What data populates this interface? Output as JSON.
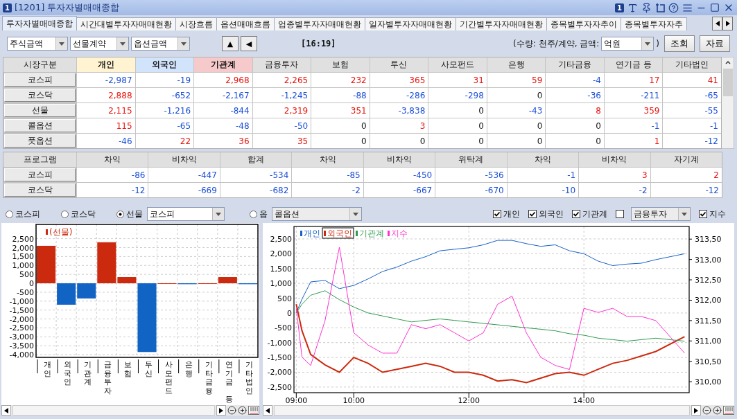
{
  "window": {
    "badge": "1",
    "title": "[1201] 투자자별매매종합",
    "toolbar_badge": "1"
  },
  "tabs": [
    {
      "label": "투자자별매매종합",
      "selected": true
    },
    {
      "label": "시간대별투자자매매현황",
      "selected": false
    },
    {
      "label": "시장흐름",
      "selected": false
    },
    {
      "label": "옵션매매흐름",
      "selected": false
    },
    {
      "label": "업종별투자자매매현황",
      "selected": false
    },
    {
      "label": "일자별투자자매매현황",
      "selected": false
    },
    {
      "label": "기간별투자자매매현황",
      "selected": false
    },
    {
      "label": "종목별투자자추이",
      "selected": false
    },
    {
      "label": "종목별투자자추",
      "selected": false
    }
  ],
  "controls": {
    "dropdowns": [
      "주식금액",
      "선물계약",
      "옵션금액"
    ],
    "nav_buttons": [
      "▲",
      "◀"
    ],
    "time": "[16:19]",
    "unit_prefix": "(수량: 천주/계약, 금액:",
    "unit_dropdown": "억원",
    "unit_suffix": ")",
    "buttons": [
      "조회",
      "자료"
    ]
  },
  "market_table": {
    "columns": [
      {
        "label": "시장구분"
      },
      {
        "label": "개인",
        "color": "#fff3d2"
      },
      {
        "label": "외국인",
        "color": "#d2e4fb"
      },
      {
        "label": "기관계",
        "color": "#f6caca"
      },
      {
        "label": "금융투자"
      },
      {
        "label": "보험"
      },
      {
        "label": "투신"
      },
      {
        "label": "사모펀드"
      },
      {
        "label": "은행"
      },
      {
        "label": "기타금융"
      },
      {
        "label": "연기금 등"
      },
      {
        "label": "기타법인"
      }
    ],
    "rows": [
      {
        "name": "코스피",
        "cells": [
          "-2,987",
          "-19",
          "2,968",
          "2,265",
          "232",
          "365",
          "31",
          "59",
          "-4",
          "17",
          "41"
        ]
      },
      {
        "name": "코스닥",
        "cells": [
          "2,888",
          "-652",
          "-2,167",
          "-1,245",
          "-88",
          "-286",
          "-298",
          "0",
          "-36",
          "-211",
          "-65"
        ]
      },
      {
        "name": "선물",
        "cells": [
          "2,115",
          "-1,216",
          "-844",
          "2,319",
          "351",
          "-3,838",
          "0",
          "-43",
          "8",
          "359",
          "-55"
        ]
      },
      {
        "name": "콜옵션",
        "cells": [
          "115",
          "-65",
          "-48",
          "-50",
          "0",
          "3",
          "0",
          "0",
          "0",
          "-1",
          "-1"
        ]
      },
      {
        "name": "풋옵션",
        "cells": [
          "-46",
          "22",
          "36",
          "35",
          "0",
          "0",
          "0",
          "0",
          "0",
          "1",
          "-12"
        ]
      }
    ]
  },
  "program_table": {
    "columns": [
      "프로그램",
      "차익",
      "비차익",
      "합계",
      "차익",
      "비차익",
      "위탁계",
      "차익",
      "비차익",
      "자기계"
    ],
    "rows": [
      {
        "name": "코스피",
        "cells": [
          "-86",
          "-447",
          "-534",
          "-85",
          "-450",
          "-536",
          "-1",
          "3",
          "2"
        ]
      },
      {
        "name": "코스닥",
        "cells": [
          "-12",
          "-669",
          "-682",
          "-2",
          "-667",
          "-670",
          "-10",
          "-2",
          "-12"
        ]
      }
    ]
  },
  "market_radios": [
    {
      "label": "코스피",
      "selected": false
    },
    {
      "label": "코스닥",
      "selected": false
    },
    {
      "label": "선물",
      "selected": true
    },
    {
      "label": "옵",
      "selected": false
    }
  ],
  "futures_dropdown": "코스피",
  "option_dropdown": "콜옵션",
  "series_checks": [
    {
      "label": "개인",
      "checked": true,
      "kind": "check"
    },
    {
      "label": "외국인",
      "checked": true,
      "kind": "check"
    },
    {
      "label": "기관계",
      "checked": true,
      "kind": "check"
    },
    {
      "label": "금융투자",
      "checked": false,
      "kind": "dropdown"
    },
    {
      "label": "지수",
      "checked": true,
      "kind": "check"
    }
  ],
  "bar_chart": {
    "chart_data": {
      "type": "bar",
      "categories": [
        "개인",
        "외국인",
        "기관계",
        "금융투자",
        "보험",
        "투신",
        "사모펀드",
        "은행",
        "기타금융",
        "연기금 등",
        "기타법인"
      ],
      "series": [
        {
          "name": "(선물)",
          "color": "#cc2a0e",
          "values": [
            2100,
            null,
            null,
            2300,
            350,
            null,
            0,
            null,
            0,
            350,
            null
          ]
        },
        {
          "color": "#1264c4",
          "values": [
            null,
            -1200,
            -850,
            null,
            null,
            -3850,
            null,
            -50,
            null,
            null,
            -50
          ]
        }
      ],
      "stacked": true,
      "grid": true,
      "ylim": [
        -4150,
        3300
      ],
      "yticks": [
        {
          "value": 2500,
          "label": "2,500"
        },
        {
          "value": 2000,
          "label": "2,000"
        },
        {
          "value": 1500,
          "label": "1,500"
        },
        {
          "value": 1000,
          "label": "1,000"
        },
        {
          "value": 500,
          "label": "500"
        },
        {
          "value": 0,
          "label": "0"
        },
        {
          "value": -500,
          "label": "-500"
        },
        {
          "value": -1000,
          "label": "-1,000"
        },
        {
          "value": -1500,
          "label": "-1,500"
        },
        {
          "value": -2000,
          "label": "-2,000"
        },
        {
          "value": -2500,
          "label": "-2,500"
        },
        {
          "value": -3000,
          "label": "-3,000"
        },
        {
          "value": -3500,
          "label": "-3,500"
        },
        {
          "value": -4000,
          "label": "-4,000"
        }
      ]
    }
  },
  "line_chart": {
    "chart_data": {
      "type": "line",
      "x": [
        9,
        9.1,
        9.25,
        9.5,
        9.75,
        10,
        10.25,
        10.5,
        10.75,
        11,
        11.25,
        11.5,
        11.75,
        12,
        12.25,
        12.5,
        12.75,
        13,
        13.25,
        13.5,
        13.75,
        14,
        14.25,
        14.5,
        14.75,
        15,
        15.25,
        15.75
      ],
      "series": [
        {
          "name": "개인",
          "color": "#1560c8",
          "values": [
            0,
            470,
            1050,
            1100,
            820,
            930,
            1150,
            1400,
            1550,
            1750,
            1900,
            2100,
            2150,
            2200,
            2300,
            2450,
            2450,
            2340,
            2250,
            2300,
            2100,
            2000,
            1750,
            1600,
            1650,
            1680,
            1800,
            2000
          ]
        },
        {
          "name": "외국인",
          "color": "#cc2a0e",
          "values": [
            300,
            -600,
            -1400,
            -1750,
            -2000,
            -1500,
            -1700,
            -2000,
            -1900,
            -1800,
            -1700,
            -1800,
            -2000,
            -2000,
            -2100,
            -2300,
            -2250,
            -2350,
            -2200,
            -2050,
            -2000,
            -2100,
            -1900,
            -1700,
            -1600,
            -1450,
            -1300,
            -800
          ]
        },
        {
          "name": "기관계",
          "color": "#2e9a4c",
          "values": [
            0,
            300,
            600,
            750,
            450,
            200,
            0,
            -100,
            -200,
            -300,
            -250,
            -200,
            -250,
            -300,
            -350,
            -400,
            -450,
            -500,
            -550,
            -600,
            -700,
            -750,
            -850,
            -900,
            -950,
            -900,
            -850,
            -950
          ]
        },
        {
          "name": "지수",
          "color": "#ff2fd0",
          "axis": "y2",
          "values": [
            311.8,
            310.6,
            310.4,
            311.5,
            313.3,
            311.2,
            310.9,
            310.7,
            310.7,
            311.4,
            311.3,
            311.4,
            311.2,
            311.0,
            311.2,
            311.9,
            312.1,
            311.2,
            310.6,
            310.4,
            310.3,
            311.8,
            311.7,
            311.8,
            311.6,
            311.6,
            311.5,
            310.7
          ]
        }
      ],
      "xlim": [
        8.96,
        15.83
      ],
      "grid": true,
      "legend": "upper left",
      "xticks": [
        {
          "value": 9,
          "label": "09:00"
        },
        {
          "value": 10,
          "label": "10:00"
        },
        {
          "value": 12,
          "label": "12:00"
        },
        {
          "value": 14,
          "label": "14:00"
        }
      ],
      "ylim": [
        -2690,
        2920
      ],
      "yticks": [
        {
          "value": 2500,
          "label": "2,500"
        },
        {
          "value": 2000,
          "label": "2,000"
        },
        {
          "value": 1500,
          "label": "1,500"
        },
        {
          "value": 1000,
          "label": "1,000"
        },
        {
          "value": 500,
          "label": "500"
        },
        {
          "value": 0,
          "label": "0"
        },
        {
          "value": -500,
          "label": "-500"
        },
        {
          "value": -1000,
          "label": "-1,000"
        },
        {
          "value": -1500,
          "label": "-1,500"
        },
        {
          "value": -2000,
          "label": "-2,000"
        },
        {
          "value": -2500,
          "label": "-2,500"
        }
      ],
      "y2lim": [
        309.73,
        313.81
      ],
      "y2ticks": [
        {
          "value": 313.5,
          "label": "313,50"
        },
        {
          "value": 313,
          "label": "313,00"
        },
        {
          "value": 312.5,
          "label": "312,50"
        },
        {
          "value": 312,
          "label": "312,00"
        },
        {
          "value": 311.5,
          "label": "311,50"
        },
        {
          "value": 311,
          "label": "311,00"
        },
        {
          "value": 310.5,
          "label": "310,50"
        },
        {
          "value": 310,
          "label": "310,00"
        }
      ]
    },
    "legend_items": [
      {
        "selected": false
      },
      {
        "selected": true
      },
      {
        "selected": false
      },
      {
        "selected": false
      }
    ]
  }
}
